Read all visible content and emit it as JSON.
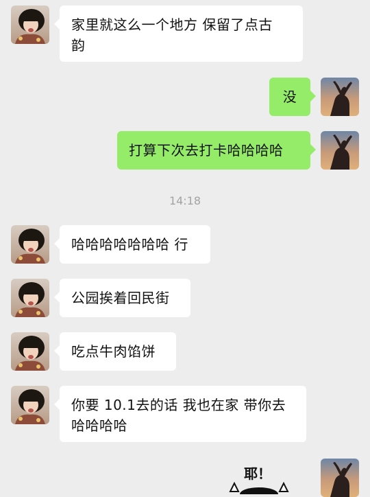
{
  "colors": {
    "background": "#ededed",
    "incoming_bubble": "#ffffff",
    "outgoing_bubble": "#95ec69",
    "timestamp": "#a3a3a3"
  },
  "messages": [
    {
      "side": "left",
      "text_line1": "家里就这么一个地方 保留了点古",
      "text_line2": "韵"
    },
    {
      "side": "right",
      "text": "没"
    },
    {
      "side": "right",
      "text": "打算下次去打卡哈哈哈哈"
    },
    {
      "side": "left",
      "text": "哈哈哈哈哈哈哈 行"
    },
    {
      "side": "left",
      "text": "公园挨着回民街"
    },
    {
      "side": "left",
      "text": "吃点牛肉馅饼"
    },
    {
      "side": "left",
      "text_line1": "你要 10.1去的话 我也在家 带你去",
      "text_line2": "哈哈哈哈"
    }
  ],
  "timestamp": "14:18",
  "sticker": {
    "text": "耶！",
    "icon": "cat-sticker-icon"
  },
  "avatars": {
    "left_icon": "girl-avatar-icon",
    "right_icon": "silhouette-avatar-icon"
  }
}
